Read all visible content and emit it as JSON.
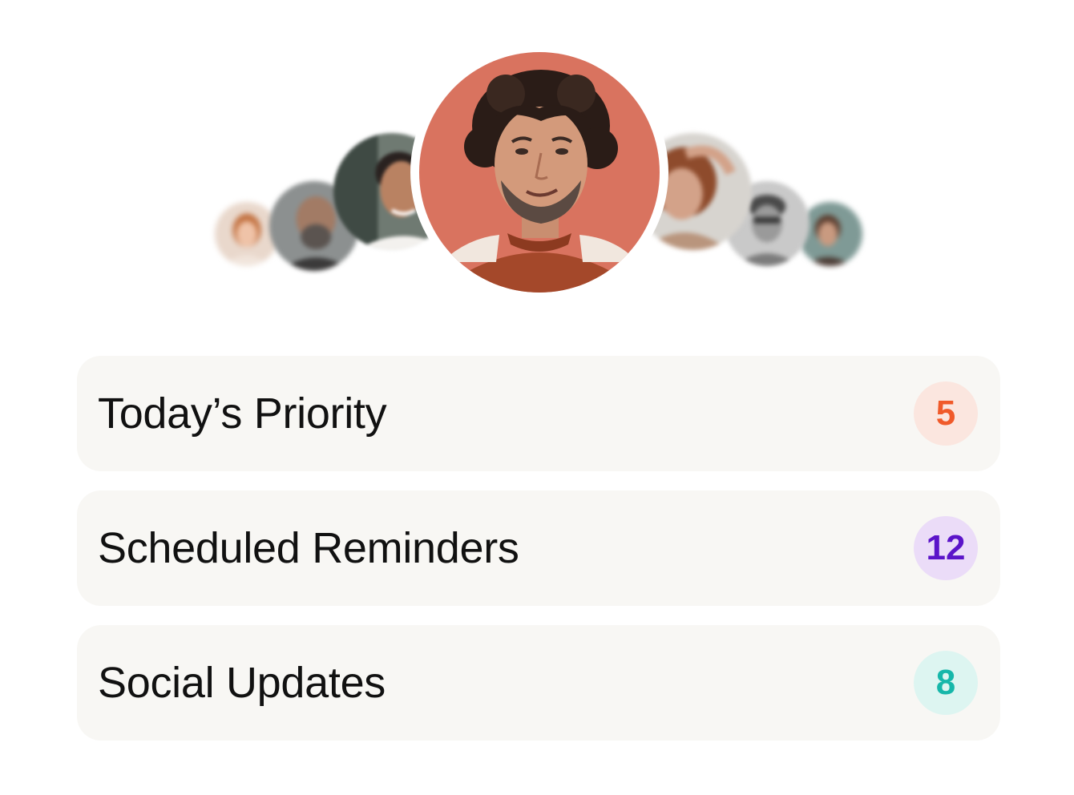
{
  "avatars": {
    "main_avatar_icon": "person-photo",
    "side_avatar_icon": "person-photo"
  },
  "list": {
    "items": [
      {
        "label": "Today’s Priority",
        "count": "5",
        "badge_color": "#f05a2a",
        "badge_bg": "#fbe6df"
      },
      {
        "label": "Scheduled Reminders",
        "count": "12",
        "badge_color": "#5b14c9",
        "badge_bg": "#ebdcf8"
      },
      {
        "label": "Social Updates",
        "count": "8",
        "badge_color": "#16b7aa",
        "badge_bg": "#ddf5f1"
      }
    ]
  },
  "colors": {
    "row_background": "#f8f7f4",
    "main_avatar_background": "#d9735f"
  }
}
